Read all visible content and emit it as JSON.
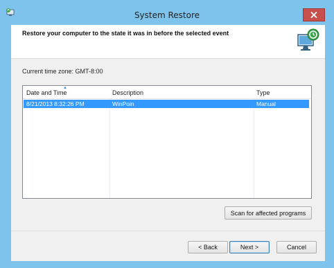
{
  "window": {
    "title": "System Restore",
    "colors": {
      "frame": "#7ec3eb",
      "close": "#c7504c",
      "selection": "#3399ff"
    }
  },
  "header": {
    "instruction": "Restore your computer to the state it was in before the selected event",
    "icon": "system-restore-monitor-icon"
  },
  "timezone": {
    "text": "Current time zone: GMT-8:00"
  },
  "list": {
    "columns": [
      "Date and Time",
      "Description",
      "Type"
    ],
    "rows": [
      {
        "date_time": "8/21/2013 8:32:26 PM",
        "description": "WinPoin",
        "type": "Manual",
        "selected": true
      }
    ]
  },
  "buttons": {
    "scan": "Scan for affected programs",
    "back": "< Back",
    "next": "Next >",
    "cancel": "Cancel"
  }
}
